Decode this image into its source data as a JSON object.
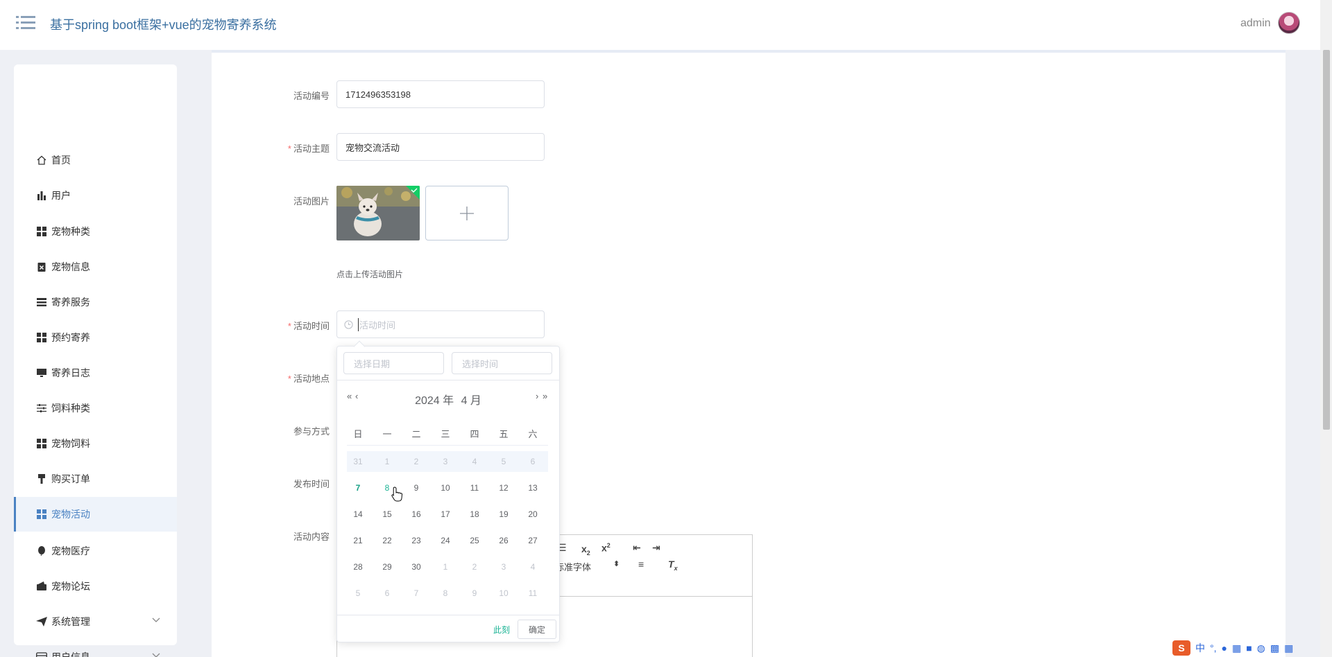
{
  "header": {
    "title": "基于spring boot框架+vue的宠物寄养系统",
    "user": "admin"
  },
  "sidebar": {
    "items": [
      {
        "label": "首页",
        "icon": "home-icon"
      },
      {
        "label": "用户",
        "icon": "bar-chart-icon"
      },
      {
        "label": "宠物种类",
        "icon": "grid-icon"
      },
      {
        "label": "宠物信息",
        "icon": "clipboard-x-icon"
      },
      {
        "label": "寄养服务",
        "icon": "list-icon"
      },
      {
        "label": "预约寄养",
        "icon": "grid-icon"
      },
      {
        "label": "寄养日志",
        "icon": "monitor-icon"
      },
      {
        "label": "饲料种类",
        "icon": "sliders-icon"
      },
      {
        "label": "宠物饲料",
        "icon": "grid-icon"
      },
      {
        "label": "购买订单",
        "icon": "brush-icon"
      },
      {
        "label": "宠物活动",
        "icon": "grid-icon",
        "active": true
      },
      {
        "label": "宠物医疗",
        "icon": "balloon-icon"
      },
      {
        "label": "宠物论坛",
        "icon": "wallet-icon"
      },
      {
        "label": "系统管理",
        "icon": "send-icon",
        "expandable": true
      },
      {
        "label": "用户信息",
        "icon": "card-icon",
        "expandable": true
      }
    ]
  },
  "form": {
    "code_label": "活动编号",
    "code_value": "1712496353198",
    "topic_label": "活动主题",
    "topic_value": "宠物交流活动",
    "image_label": "活动图片",
    "upload_tip": "点击上传活动图片",
    "time_label": "活动时间",
    "time_placeholder": "活动时间",
    "place_label": "活动地点",
    "method_label": "参与方式",
    "publish_label": "发布时间",
    "content_label": "活动内容",
    "required_mark": "*"
  },
  "editor": {
    "font_select": "标准字体"
  },
  "picker": {
    "date_placeholder": "选择日期",
    "time_placeholder": "选择时间",
    "year_label": "2024 年",
    "month_label": "4 月",
    "weekdays": [
      "日",
      "一",
      "二",
      "三",
      "四",
      "五",
      "六"
    ],
    "rows": [
      [
        "31",
        "1",
        "2",
        "3",
        "4",
        "5",
        "6"
      ],
      [
        "7",
        "8",
        "9",
        "10",
        "11",
        "12",
        "13"
      ],
      [
        "14",
        "15",
        "16",
        "17",
        "18",
        "19",
        "20"
      ],
      [
        "21",
        "22",
        "23",
        "24",
        "25",
        "26",
        "27"
      ],
      [
        "28",
        "29",
        "30",
        "1",
        "2",
        "3",
        "4"
      ],
      [
        "5",
        "6",
        "7",
        "8",
        "9",
        "10",
        "11"
      ]
    ],
    "today": "7",
    "now_label": "此刻",
    "ok_label": "确定"
  },
  "colors": {
    "accent": "#4a82c2",
    "picker_accent": "#1ab394",
    "required": "#f56c6c"
  }
}
